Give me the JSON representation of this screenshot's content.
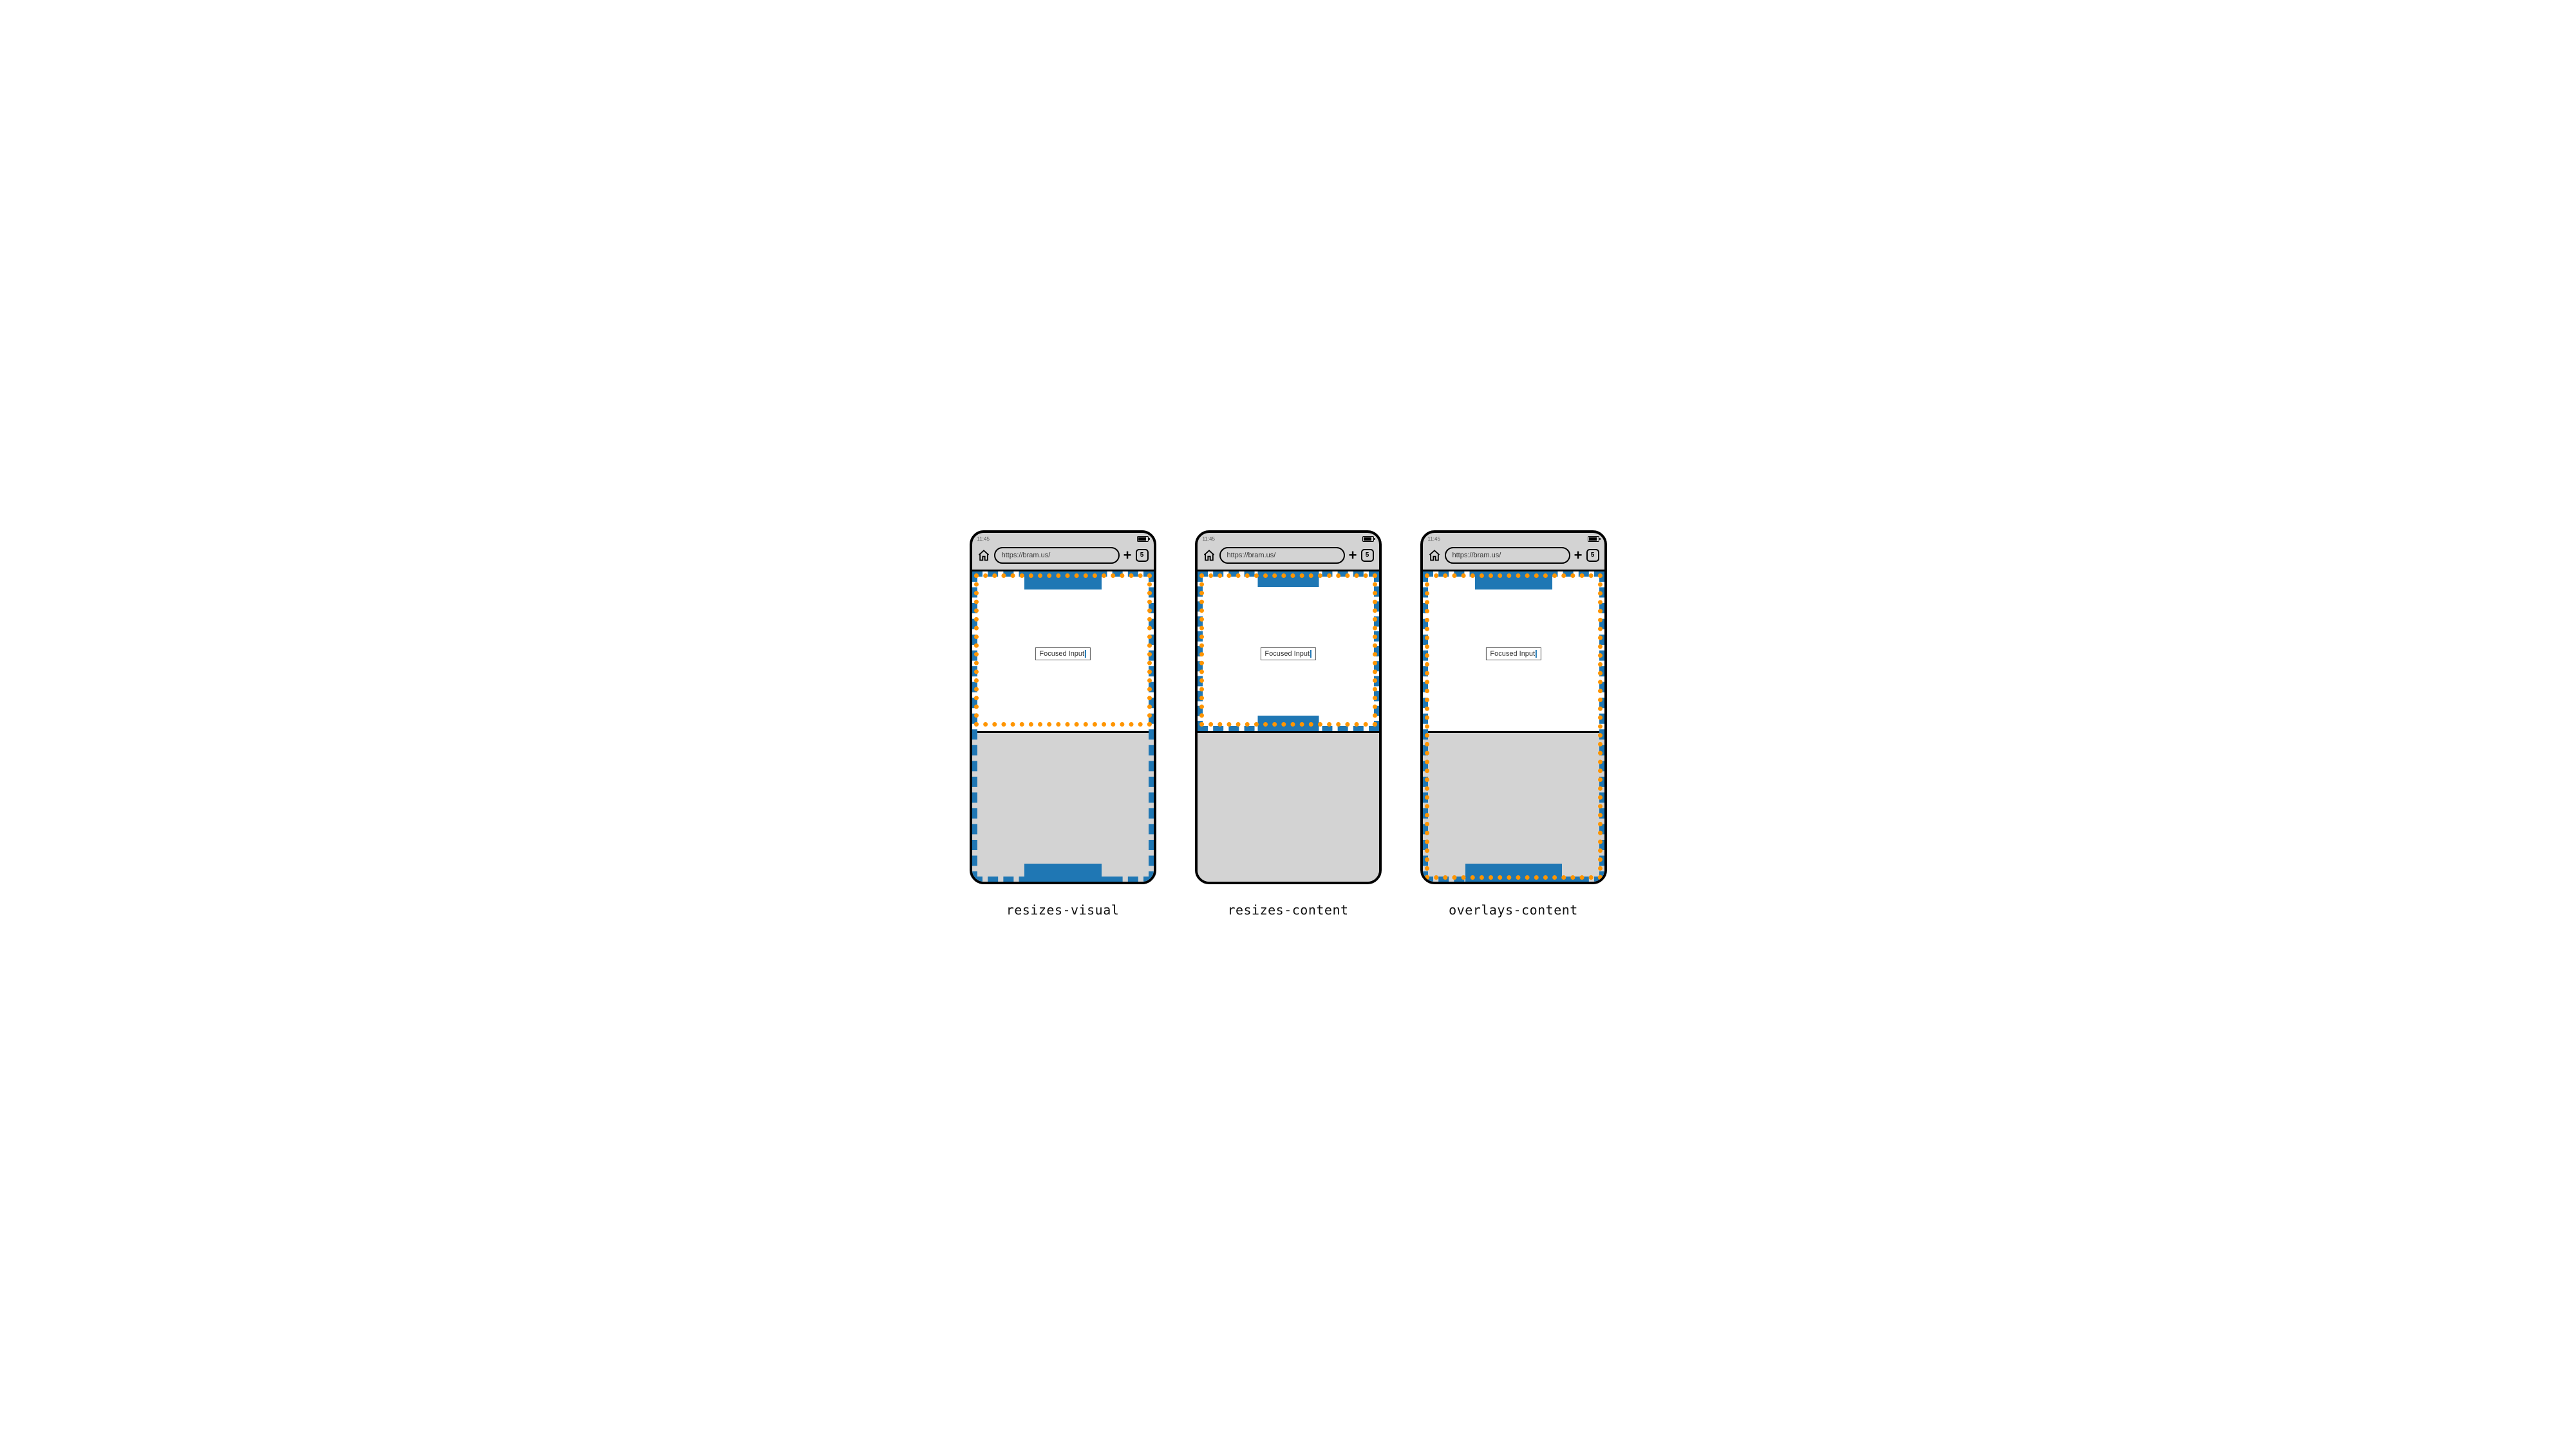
{
  "status": {
    "time": "11:45"
  },
  "browser": {
    "url": "https://bram.us/",
    "tab_count": "5"
  },
  "input_label": "Focused Input",
  "panels": [
    {
      "caption": "resizes-visual"
    },
    {
      "caption": "resizes-content"
    },
    {
      "caption": "overlays-content"
    }
  ],
  "colors": {
    "layout_viewport": "#1f77b4",
    "visual_viewport": "#ff9500",
    "keyboard": "#d3d3d3"
  }
}
